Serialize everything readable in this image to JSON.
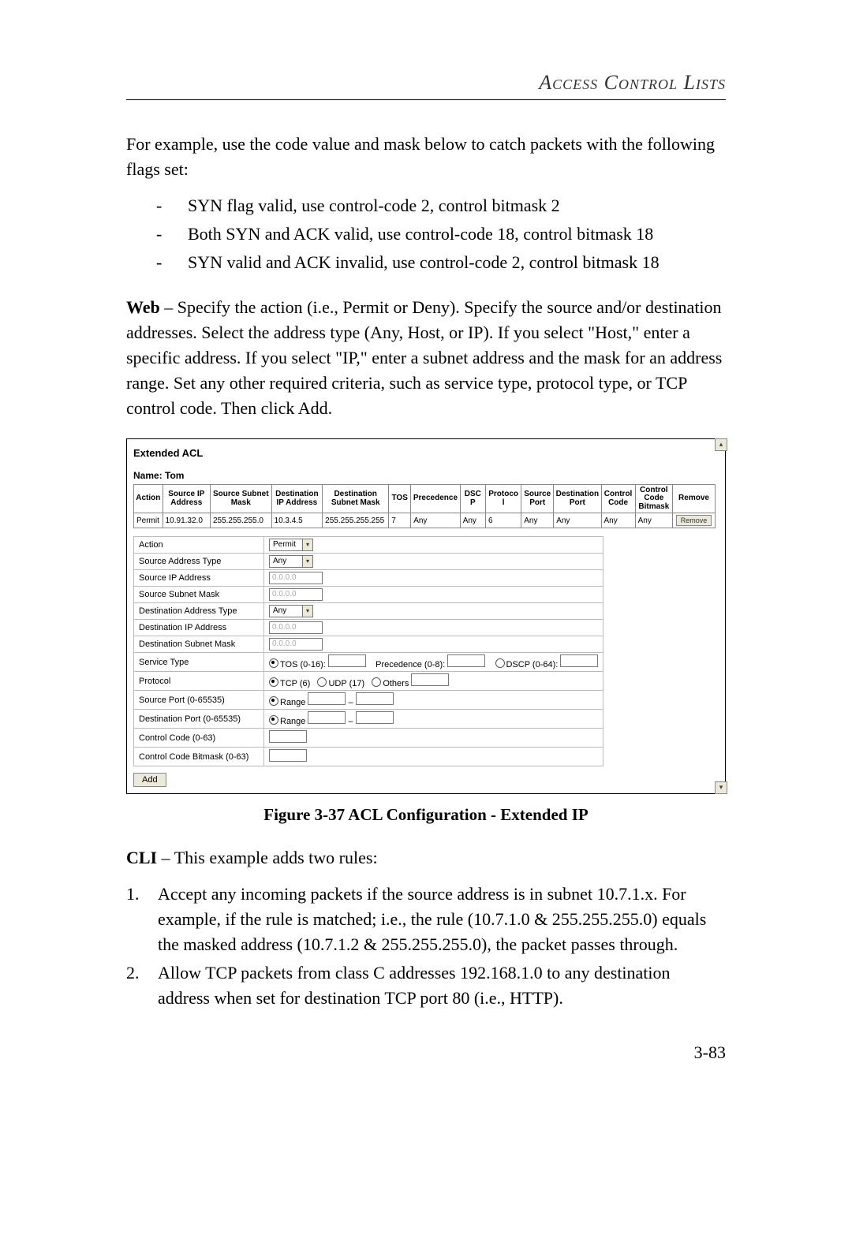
{
  "header": {
    "title": "Access Control Lists"
  },
  "intro": {
    "p1": "For example, use the code value and mask below to catch packets with the following flags set:",
    "flags": [
      "SYN flag valid, use control-code 2, control bitmask 2",
      "Both SYN and ACK valid, use control-code 18, control bitmask 18",
      "SYN valid and ACK invalid, use control-code 2, control bitmask 18"
    ]
  },
  "web": {
    "label": "Web",
    "text": " – Specify the action (i.e., Permit or Deny). Specify the source and/or destination addresses. Select the address type (Any, Host, or IP). If you select \"Host,\" enter a specific address. If you select \"IP,\" enter a subnet address and the mask for an address range. Set any other required criteria, such as service type, protocol type, or TCP control code. Then click Add."
  },
  "figure": {
    "title": "Extended ACL",
    "name_label": "Name: ",
    "name_value": "Tom",
    "columns": [
      "Action",
      "Source IP Address",
      "Source Subnet Mask",
      "Destination IP Address",
      "Destination Subnet Mask",
      "TOS",
      "Precedence",
      "DSCP",
      "Protocol",
      "Source Port",
      "Destination Port",
      "Control Code",
      "Control Code Bitmask",
      "Remove"
    ],
    "row": {
      "action": "Permit",
      "src_ip": "10.91.32.0",
      "src_mask": "255.255.255.0",
      "dst_ip": "10.3.4.5",
      "dst_mask": "255.255.255.255",
      "tos": "7",
      "prec": "Any",
      "dscp": "Any",
      "proto": "6",
      "sport": "Any",
      "dport": "Any",
      "ccode": "Any",
      "cmask": "Any",
      "remove": "Remove"
    },
    "form": {
      "action": {
        "label": "Action",
        "value": "Permit"
      },
      "src_type": {
        "label": "Source Address Type",
        "value": "Any"
      },
      "src_ip": {
        "label": "Source IP Address",
        "ph": "0.0.0.0"
      },
      "src_mask": {
        "label": "Source Subnet Mask",
        "ph": "0.0.0.0"
      },
      "dst_type": {
        "label": "Destination Address Type",
        "value": "Any"
      },
      "dst_ip": {
        "label": "Destination IP Address",
        "ph": "0.0.0.0"
      },
      "dst_mask": {
        "label": "Destination Subnet Mask",
        "ph": "0.0.0.0"
      },
      "svc": {
        "label": "Service Type",
        "tos": "TOS (0-16):",
        "prec": "Precedence (0-8):",
        "dscp": "DSCP (0-64):"
      },
      "proto": {
        "label": "Protocol",
        "tcp": "TCP (6)",
        "udp": "UDP (17)",
        "others": "Others"
      },
      "sport": {
        "label": "Source Port (0-65535)",
        "range": "Range"
      },
      "dport": {
        "label": "Destination Port (0-65535)",
        "range": "Range"
      },
      "ccode": {
        "label": "Control Code (0-63)"
      },
      "cmask": {
        "label": "Control Code Bitmask (0-63)"
      }
    },
    "add_btn": "Add"
  },
  "caption": "Figure 3-37   ACL Configuration - Extended IP",
  "cli": {
    "label": "CLI",
    "intro": " – This example adds two rules:",
    "items": [
      "Accept any incoming packets if the source address is in subnet 10.7.1.x. For example, if the rule is matched; i.e., the rule (10.7.1.0 & 255.255.255.0) equals the masked address (10.7.1.2 & 255.255.255.0), the packet passes through.",
      "Allow TCP packets from class C addresses 192.168.1.0 to any destination address when set for destination TCP port 80 (i.e., HTTP)."
    ]
  },
  "page_number": "3-83"
}
